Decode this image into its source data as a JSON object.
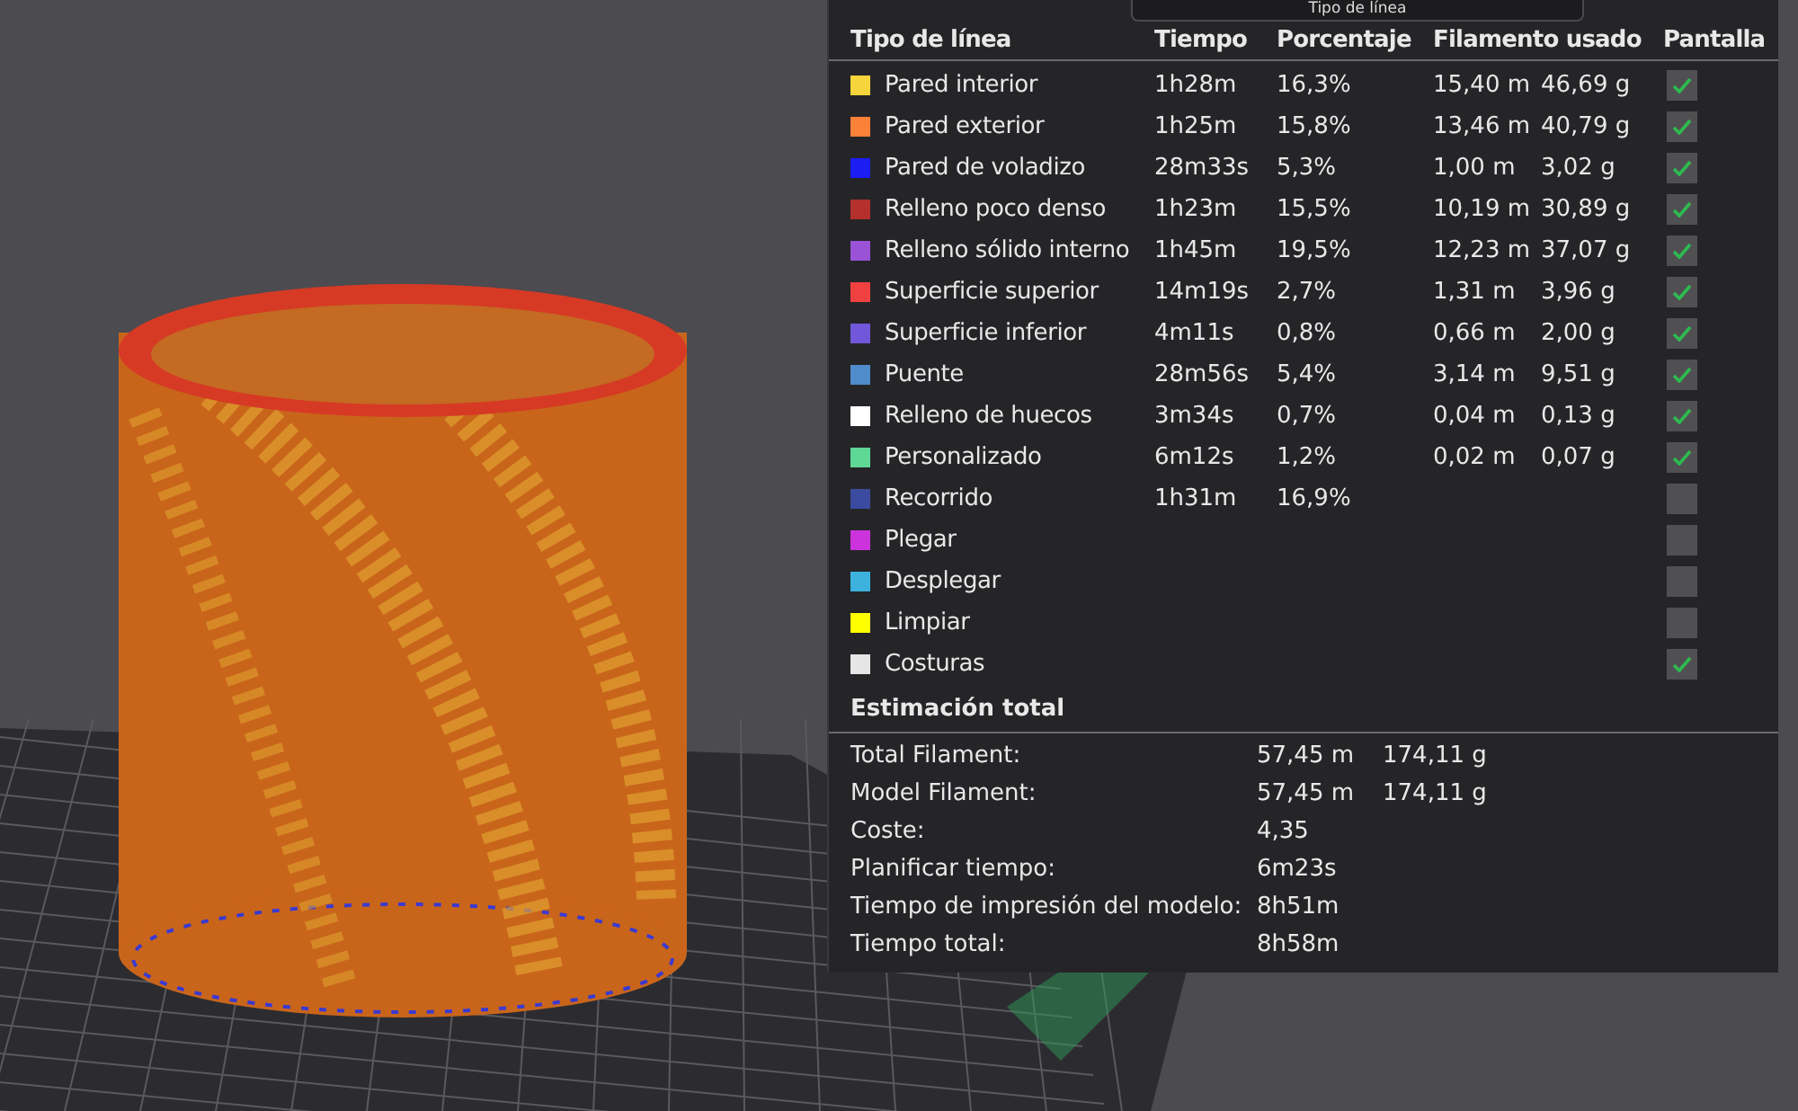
{
  "view_selector": {
    "value": "Tipo de línea"
  },
  "table": {
    "columns": [
      "Tipo de línea",
      "Tiempo",
      "Porcentaje",
      "Filamento usado",
      "Pantalla"
    ],
    "rows": [
      {
        "color": "#f5d43c",
        "name": "Pared interior",
        "time": "1h28m",
        "percentage": "16,3%",
        "length": "15,40 m",
        "weight": "46,69 g",
        "shown": true
      },
      {
        "color": "#fb8038",
        "name": "Pared exterior",
        "time": "1h25m",
        "percentage": "15,8%",
        "length": "13,46 m",
        "weight": "40,79 g",
        "shown": true
      },
      {
        "color": "#1c1cf5",
        "name": "Pared de voladizo",
        "time": "28m33s",
        "percentage": "5,3%",
        "length": "1,00 m",
        "weight": "3,02 g",
        "shown": true
      },
      {
        "color": "#b3302c",
        "name": "Relleno poco denso",
        "time": "1h23m",
        "percentage": "15,5%",
        "length": "10,19 m",
        "weight": "30,89 g",
        "shown": true
      },
      {
        "color": "#9a52d6",
        "name": "Relleno sólido interno",
        "time": "1h45m",
        "percentage": "19,5%",
        "length": "12,23 m",
        "weight": "37,07 g",
        "shown": true
      },
      {
        "color": "#f04141",
        "name": "Superficie superior",
        "time": "14m19s",
        "percentage": "2,7%",
        "length": "1,31 m",
        "weight": "3,96 g",
        "shown": true
      },
      {
        "color": "#7157d9",
        "name": "Superficie inferior",
        "time": "4m11s",
        "percentage": "0,8%",
        "length": "0,66 m",
        "weight": "2,00 g",
        "shown": true
      },
      {
        "color": "#4f8ccb",
        "name": "Puente",
        "time": "28m56s",
        "percentage": "5,4%",
        "length": "3,14 m",
        "weight": "9,51 g",
        "shown": true
      },
      {
        "color": "#ffffff",
        "name": "Relleno de huecos",
        "time": "3m34s",
        "percentage": "0,7%",
        "length": "0,04 m",
        "weight": "0,13 g",
        "shown": true
      },
      {
        "color": "#5fd896",
        "name": "Personalizado",
        "time": "6m12s",
        "percentage": "1,2%",
        "length": "0,02 m",
        "weight": "0,07 g",
        "shown": true
      },
      {
        "color": "#3a4ba0",
        "name": "Recorrido",
        "time": "1h31m",
        "percentage": "16,9%",
        "shown": false
      },
      {
        "color": "#cc33dc",
        "name": "Plegar",
        "shown": false
      },
      {
        "color": "#3db2dc",
        "name": "Desplegar",
        "shown": false
      },
      {
        "color": "#ffff00",
        "name": "Limpiar",
        "shown": false
      },
      {
        "color": "#e6e6e6",
        "name": "Costuras",
        "shown": true
      }
    ]
  },
  "summary": {
    "title": "Estimación total",
    "items": [
      {
        "label": "Total Filament:",
        "values": [
          "57,45 m",
          "174,11 g"
        ]
      },
      {
        "label": "Model Filament:",
        "values": [
          "57,45 m",
          "174,11 g"
        ]
      },
      {
        "label": "Coste:",
        "values": [
          "4,35"
        ]
      },
      {
        "label": "Planificar tiempo:",
        "values": [
          "6m23s"
        ]
      },
      {
        "label": "Tiempo de impresión del modelo:",
        "values": [
          "8h51m"
        ]
      },
      {
        "label": "Tiempo total:",
        "values": [
          "8h58m"
        ]
      }
    ]
  }
}
